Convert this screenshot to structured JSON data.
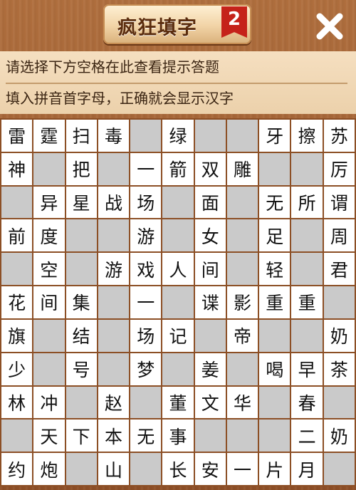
{
  "header": {
    "title": "疯狂填字",
    "level": "2"
  },
  "hint": {
    "line1": "请选择下方空格在此查看提示答题",
    "line2": "填入拼音首字母，正确就会显示汉字"
  },
  "grid": {
    "rows": [
      [
        "雷",
        "霆",
        "扫",
        "毒",
        "",
        "绿",
        "",
        "",
        "牙",
        "擦",
        "苏"
      ],
      [
        "神",
        "",
        "把",
        "",
        "一",
        "箭",
        "双",
        "雕",
        "",
        "",
        "厉"
      ],
      [
        "",
        "异",
        "星",
        "战",
        "场",
        "",
        "面",
        "",
        "无",
        "所",
        "谓"
      ],
      [
        "前",
        "度",
        "",
        "",
        "游",
        "",
        "女",
        "",
        "足",
        "",
        "周"
      ],
      [
        "",
        "空",
        "",
        "游",
        "戏",
        "人",
        "间",
        "",
        "轻",
        "",
        "君"
      ],
      [
        "花",
        "间",
        "集",
        "",
        "一",
        "",
        "谍",
        "影",
        "重",
        "重",
        ""
      ],
      [
        "旗",
        "",
        "结",
        "",
        "场",
        "记",
        "",
        "帝",
        "",
        "",
        "奶"
      ],
      [
        "少",
        "",
        "号",
        "",
        "梦",
        "",
        "姜",
        "",
        "喝",
        "早",
        "茶"
      ],
      [
        "林",
        "冲",
        "",
        "赵",
        "",
        "董",
        "文",
        "华",
        "",
        "春",
        ""
      ],
      [
        "",
        "天",
        "下",
        "本",
        "无",
        "事",
        "",
        "",
        "",
        "二",
        "奶"
      ],
      [
        "约",
        "炮",
        "",
        "山",
        "",
        "长",
        "安",
        "一",
        "片",
        "月",
        ""
      ]
    ]
  }
}
